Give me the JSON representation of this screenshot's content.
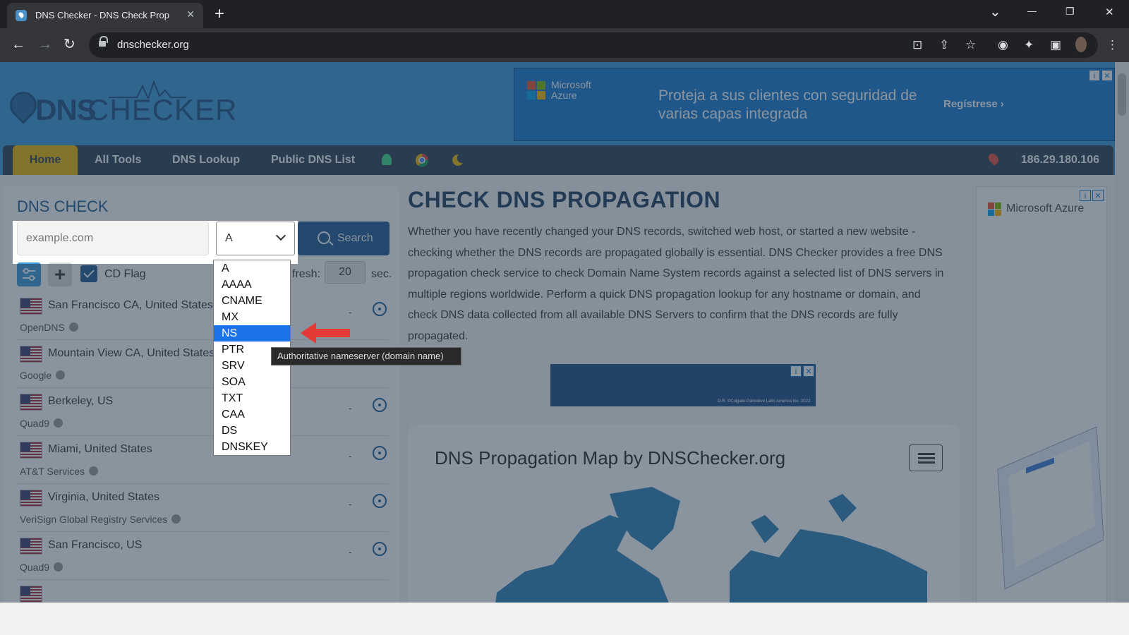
{
  "browser": {
    "tab_title": "DNS Checker - DNS Check Prop",
    "url": "dnschecker.org",
    "win_min": "—",
    "win_restore": "❐",
    "win_close": "✕",
    "new_tab": "+",
    "tab_close": "✕",
    "tab_search": "⌄"
  },
  "header": {
    "logo_dns": "DNS",
    "logo_checker": "CHECKER",
    "ad": {
      "brand": "Microsoft Azure",
      "headline": "Proteja a sus clientes con seguridad de varias capas integrada",
      "cta": "Regístrese ›"
    }
  },
  "nav": {
    "home": "Home",
    "all_tools": "All Tools",
    "dns_lookup": "DNS Lookup",
    "public_dns_list": "Public DNS List",
    "ip": "186.29.180.106"
  },
  "dns_check": {
    "title": "DNS CHECK",
    "search_placeholder": "example.com",
    "record_type": "A",
    "search_label": "Search",
    "cd_flag": "CD Flag",
    "refresh_label": "fresh:",
    "refresh_value": "20",
    "sec_label": "sec.",
    "servers": [
      {
        "location": "San Francisco CA, United States",
        "provider": "OpenDNS",
        "status": "-"
      },
      {
        "location": "Mountain View CA, United States",
        "provider": "Google",
        "status": "-"
      },
      {
        "location": "Berkeley, US",
        "provider": "Quad9",
        "status": "-"
      },
      {
        "location": "Miami, United States",
        "provider": "AT&T Services",
        "status": "-"
      },
      {
        "location": "Virginia, United States",
        "provider": "VeriSign Global Registry Services",
        "status": "-"
      },
      {
        "location": "San Francisco, US",
        "provider": "Quad9",
        "status": "-"
      }
    ]
  },
  "record_types": [
    "A",
    "AAAA",
    "CNAME",
    "MX",
    "NS",
    "PTR",
    "SRV",
    "SOA",
    "TXT",
    "CAA",
    "DS",
    "DNSKEY"
  ],
  "selected_record_type": "NS",
  "tooltip": "Authoritative nameserver (domain name)",
  "main": {
    "title": "CHECK DNS PROPAGATION",
    "description": "Whether you have recently changed your DNS records, switched web host, or started a new website - checking whether the DNS records are propagated globally is essential. DNS Checker provides a free DNS propagation check service to check Domain Name System records against a selected list of DNS servers in multiple regions worldwide. Perform a quick DNS propagation lookup for any hostname or domain, and check DNS data collected from all available DNS Servers to confirm that the DNS records are fully propagated.",
    "ad_small": "D.R. ©Colgate-Palmolive Latin America Inc. 2022.",
    "map_title": "DNS Propagation Map by DNSChecker.org"
  },
  "right_ad": {
    "brand": "Microsoft Azure"
  },
  "colors": {
    "accent": "#1d5a94",
    "nav_bg": "#2d3e50",
    "home_tab": "#f2b800",
    "header_bg": "#3a9ad9",
    "selection": "#1a73e8"
  }
}
